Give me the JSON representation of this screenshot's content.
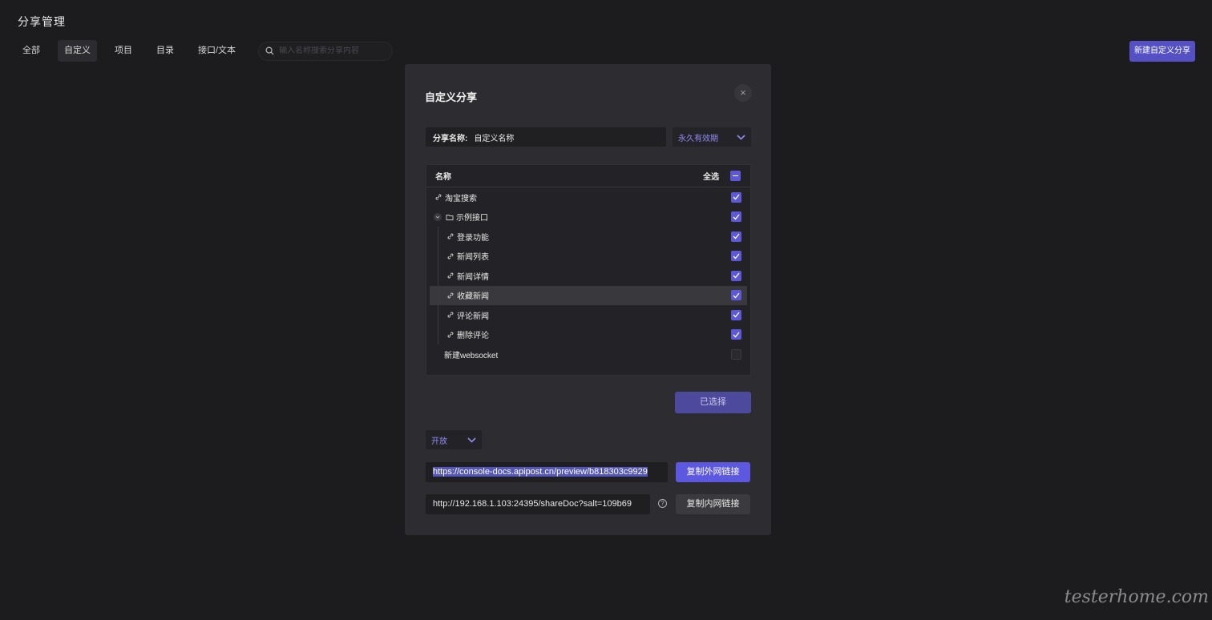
{
  "page_title": "分享管理",
  "tabs": [
    {
      "label": "全部"
    },
    {
      "label": "自定义"
    },
    {
      "label": "项目"
    },
    {
      "label": "目录"
    },
    {
      "label": "接口/文本"
    }
  ],
  "search": {
    "placeholder": "输入名称搜索分享内容"
  },
  "new_share_button": "新建自定义分享",
  "modal": {
    "title": "自定义分享",
    "close": "×",
    "name_label": "分享名称:",
    "name_value": "自定义名称",
    "expiry": "永久有效期",
    "tree_header": {
      "name": "名称",
      "select_all": "全选"
    },
    "tree_items": [
      {
        "label": "淘宝搜索",
        "type": "link",
        "checked": true
      },
      {
        "label": "示例接口",
        "type": "folder",
        "checked": true
      },
      {
        "label": "登录功能",
        "type": "link",
        "checked": true
      },
      {
        "label": "新闻列表",
        "type": "link",
        "checked": true
      },
      {
        "label": "新闻详情",
        "type": "link",
        "checked": true
      },
      {
        "label": "收藏新闻",
        "type": "link",
        "checked": true
      },
      {
        "label": "评论新闻",
        "type": "link",
        "checked": true
      },
      {
        "label": "删除评论",
        "type": "link",
        "checked": true
      },
      {
        "label": "新建websocket",
        "type": "plain",
        "checked": false
      }
    ],
    "selected_button": "已选择",
    "access": "开放",
    "external_link": "https://console-docs.apipost.cn/preview/b818303c9929",
    "copy_external": "复制外网链接",
    "internal_link": "http://192.168.1.103:24395/shareDoc?salt=109b69",
    "copy_internal": "复制内网链接"
  },
  "watermark": "testerhome.com"
}
